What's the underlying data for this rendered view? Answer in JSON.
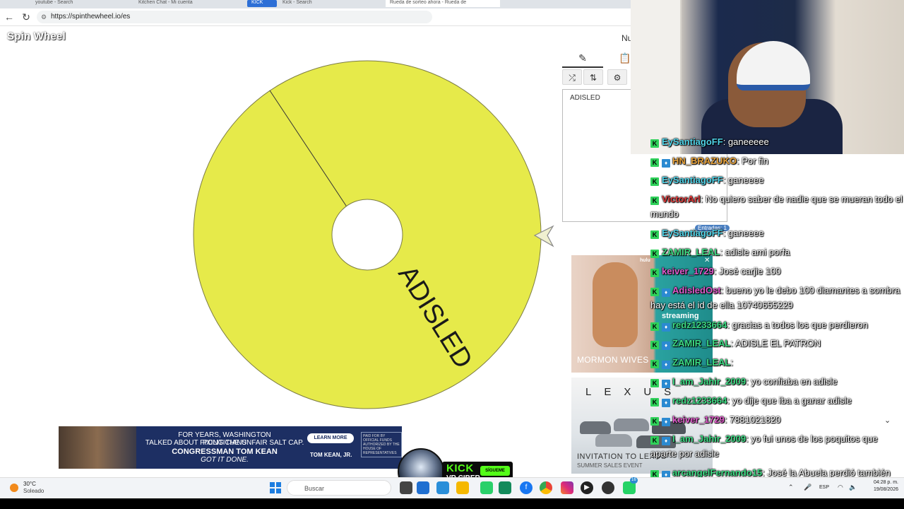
{
  "browser": {
    "tabs": [
      "youtube - Search",
      "Kitchen Chat - Mi cuenta",
      "KICK",
      "Kick - Search",
      "Rueda de sorteo ahora - Rueda de"
    ],
    "url": "https://spinthewheel.io/es"
  },
  "page": {
    "logo": "Spin Wheel",
    "top_right_fragment": "Nu",
    "wheel": {
      "color": "#e6ea4a",
      "segment_label": "ADISLED"
    },
    "entries_text": "ADISLED",
    "entries_badge": "Entradas: 1"
  },
  "ads": {
    "hulu": {
      "logo": "hulu",
      "title": "MORMON WIVES",
      "streaming": "streaming"
    },
    "lexus": {
      "logo": "LEXUS",
      "headline": "INVITATION TO LEXUS",
      "sub": "SUMMER SALES EVENT"
    },
    "banner": {
      "line1": "FOR YEARS, WASHINGTON POLITICIANS",
      "line2": "TALKED ABOUT FIXING THE UNFAIR SALT CAP.",
      "line3": "CONGRESSMAN TOM KEAN",
      "line4": "GOT IT DONE.",
      "cta": "LEARN MORE",
      "brand": "TOM KEAN, JR.",
      "paid_by": "PAID FOR BY OFFICIAL FUNDS AUTHORIZED BY THE HOUSE OF REPRESENTATIVES"
    }
  },
  "chat": {
    "messages": [
      {
        "user": "EySantiagoFF",
        "color": "#4fd3e8",
        "text": ": ganeeeee",
        "badge": "K"
      },
      {
        "user": "HN_BRAZUKO",
        "color": "#e8a23a",
        "text": ": Por fin",
        "badge": "K"
      },
      {
        "user": "EySantiagoFF",
        "color": "#4fd3e8",
        "text": ": ganeeee",
        "badge": "K"
      },
      {
        "user": "VictorArl",
        "color": "#e23c3c",
        "text": ": No quiero saber de nadie que se mueran todo el mundo",
        "badge": "K"
      },
      {
        "user": "EySantiagoFF",
        "color": "#4fd3e8",
        "text": ": ganeeee",
        "badge": "K"
      },
      {
        "user": "ZAMIR_LEAL",
        "color": "#3ddc84",
        "text": ": adisle ami porfa",
        "badge": "K"
      },
      {
        "user": "keiver_1729",
        "color": "#e05acb",
        "text": ": José carjie 100",
        "badge": "K"
      },
      {
        "user": "AdisledOst",
        "color": "#e05acb",
        "text": ": bueno yo le debo 100 diamantes a sombra hay está el id de ella 10740655229",
        "badge": "K"
      },
      {
        "user": "redz1233664",
        "color": "#3ddc84",
        "text": ": gracias a todos los que perdieron",
        "badge": "K"
      },
      {
        "user": "ZAMIR_LEAL",
        "color": "#3ddc84",
        "text": ": ADISLE EL PATRON",
        "badge": "K"
      },
      {
        "user": "ZAMIR_LEAL",
        "color": "#3ddc84",
        "text": ":",
        "badge": "K"
      },
      {
        "user": "I_am_Jahir_2009",
        "color": "#3ddc84",
        "text": ": yo confiaba en adisle",
        "badge": "K"
      },
      {
        "user": "redz1233664",
        "color": "#3ddc84",
        "text": ": yo dije que iba a ganar adisle",
        "badge": "K"
      },
      {
        "user": "keiver_1729",
        "color": "#e05acb",
        "text": ": 7881021820",
        "badge": "K"
      },
      {
        "user": "I_am_Jahir_2009",
        "color": "#3ddc84",
        "text": ": yo fui unos de los poquitos que aparte por adisle",
        "badge": "K"
      },
      {
        "user": "arcangelFernando15",
        "color": "#3ddc84",
        "text": ": José la Abuela perdió también",
        "badge": "K"
      }
    ]
  },
  "kick": {
    "label": "KICK",
    "name": "VR CIBER",
    "follow": "SÍGUEME"
  },
  "taskbar": {
    "temp": "30°C",
    "weather": "Soleado",
    "search_placeholder": "Buscar",
    "lang": "ESP",
    "time": "04:28 p. m.",
    "date": "19/08/2026",
    "badge_count": "16"
  }
}
